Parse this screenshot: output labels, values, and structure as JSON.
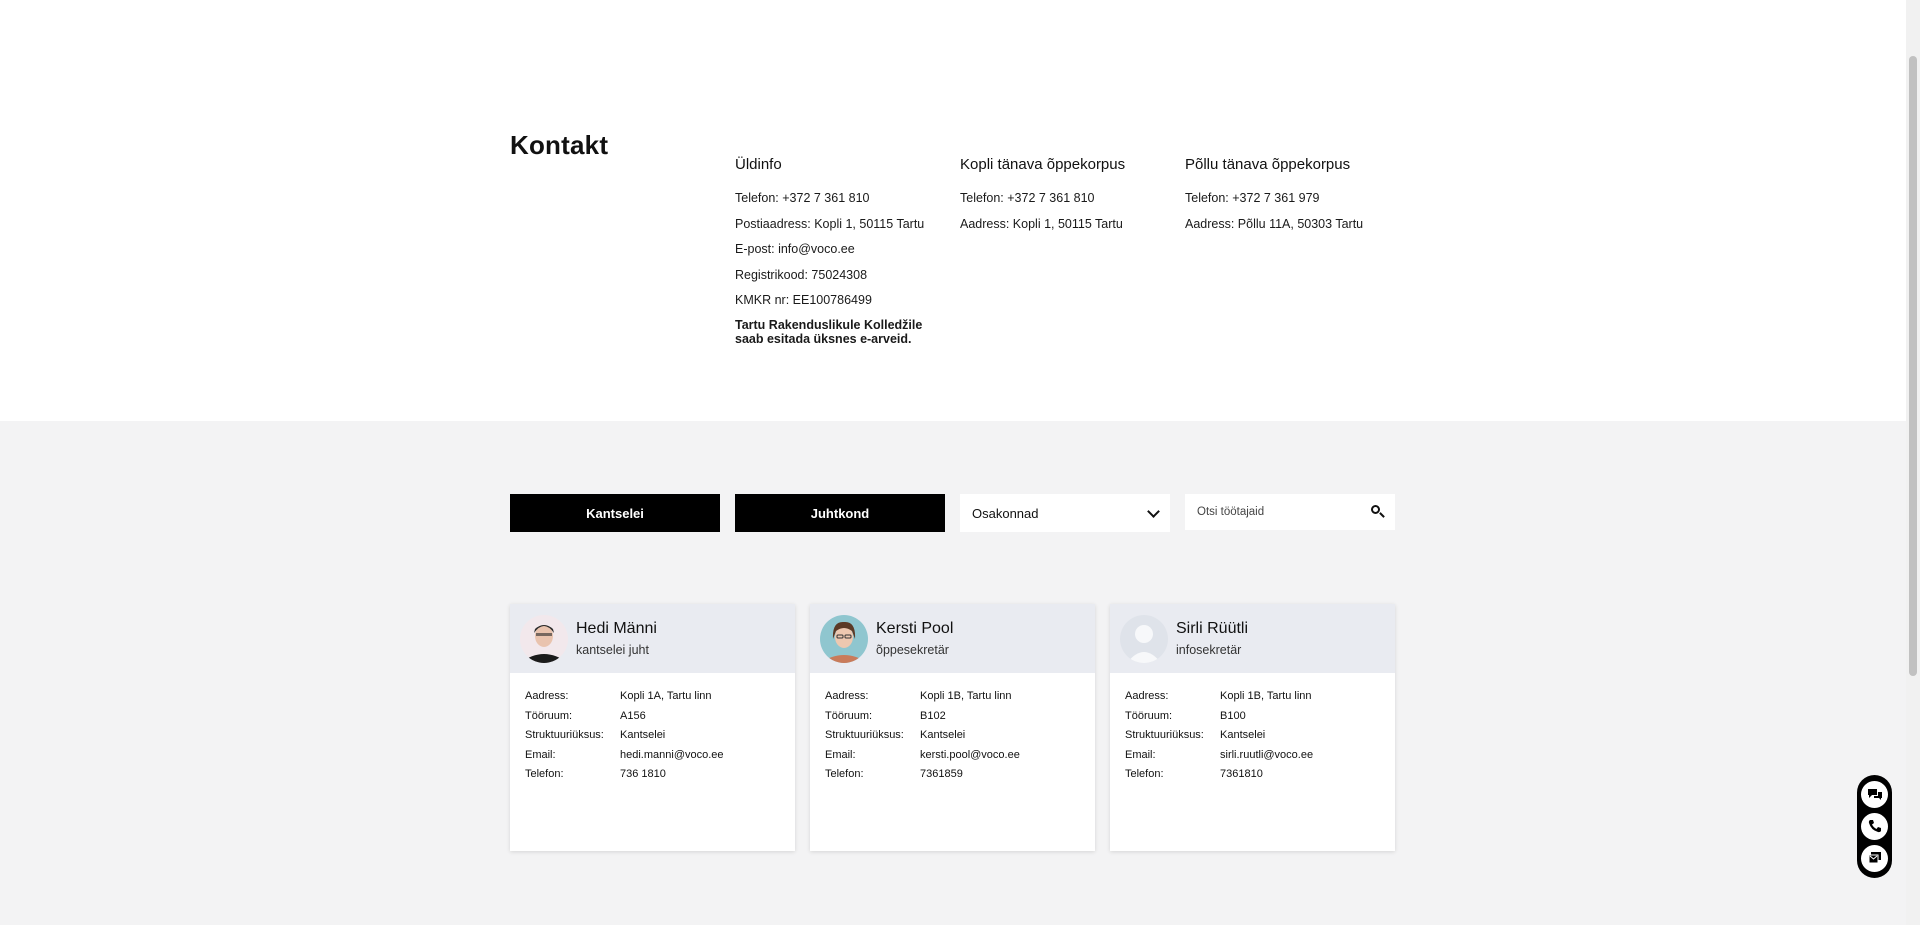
{
  "contact": {
    "title": "Kontakt",
    "columns": [
      {
        "heading": "Üldinfo",
        "lines": [
          "Telefon: +372 7 361 810",
          "Postiaadress: Kopli 1, 50115 Tartu",
          "E-post: info@voco.ee",
          "Registrikood: 75024308",
          "KMKR nr: EE100786499"
        ],
        "note": "Tartu Rakenduslikule Kolledžile saab esitada üksnes e-arveid."
      },
      {
        "heading": "Kopli tänava õppekorpus",
        "lines": [
          "Telefon: +372 7 361 810",
          "Aadress: Kopli 1, 50115 Tartu"
        ]
      },
      {
        "heading": "Põllu tänava õppekorpus",
        "lines": [
          "Telefon: +372 7 361 979",
          "Aadress: Põllu 11A, 50303 Tartu"
        ]
      }
    ]
  },
  "staff": {
    "buttons": {
      "kantselei": "Kantselei",
      "juhtkond": "Juhtkond"
    },
    "select": {
      "value": "Osakonnad"
    },
    "search": {
      "placeholder": "Otsi töötajaid"
    },
    "field_labels": {
      "address": "Aadress:",
      "room": "Tööruum:",
      "unit": "Struktuuriüksus:",
      "email": "Email:",
      "phone": "Telefon:"
    },
    "cards": [
      {
        "name": "Hedi Männi",
        "role": "kantselei juht",
        "address": "Kopli 1A, Tartu linn",
        "room": "A156",
        "unit": "Kantselei",
        "email": "hedi.manni@voco.ee",
        "phone": "736 1810"
      },
      {
        "name": "Kersti Pool",
        "role": "õppesekretär",
        "address": "Kopli 1B, Tartu linn",
        "room": "B102",
        "unit": "Kantselei",
        "email": "kersti.pool@voco.ee",
        "phone": "7361859"
      },
      {
        "name": "Sirli Rüütli",
        "role": "infosekretär",
        "address": "Kopli 1B, Tartu linn",
        "room": "B100",
        "unit": "Kantselei",
        "email": "sirli.ruutli@voco.ee",
        "phone": "7361810"
      }
    ]
  },
  "widget": {
    "icons": [
      "chat-icon",
      "phone-icon",
      "message-icon"
    ]
  },
  "colors": {
    "accent": "#000000",
    "section_bg": "#f3f3f4",
    "card_head_bg": "#e9ebf1"
  }
}
